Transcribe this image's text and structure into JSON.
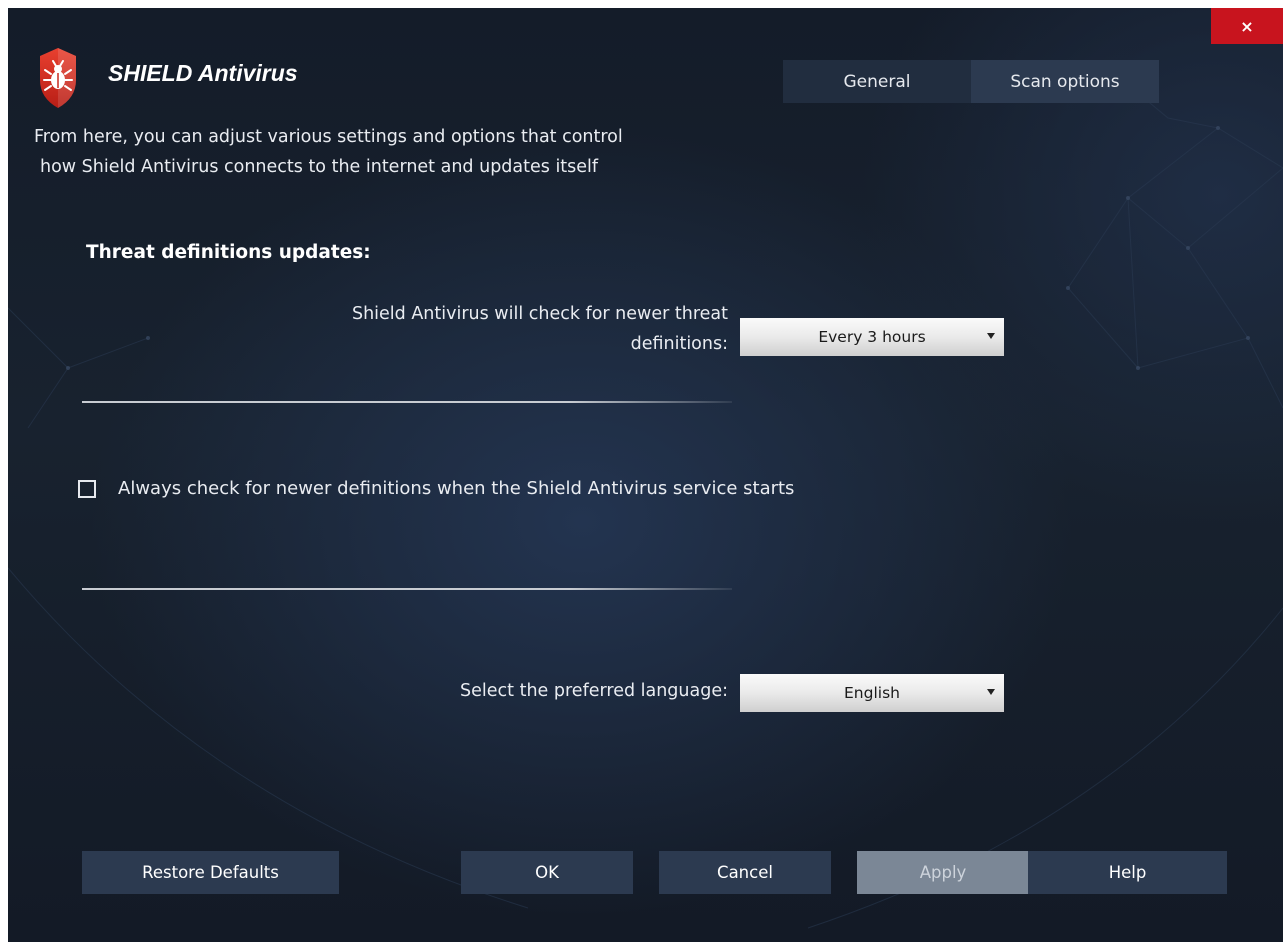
{
  "window": {
    "close_label": "×"
  },
  "header": {
    "title": "SHIELD Antivirus",
    "logo_icon": "shield-bug-icon"
  },
  "tabs": [
    {
      "label": "General"
    },
    {
      "label": "Scan options"
    }
  ],
  "description": {
    "line1": "From here, you can adjust various settings and options that control",
    "line2": "how Shield Antivirus connects to the internet and updates itself"
  },
  "updates": {
    "heading": "Threat definitions updates:",
    "check_label_line1": "Shield Antivirus will check for newer threat",
    "check_label_line2": "definitions:",
    "frequency_value": "Every 3 hours",
    "always_check_label": "Always check for newer definitions when the Shield Antivirus service starts",
    "always_check_checked": false
  },
  "language": {
    "label": "Select the preferred language:",
    "value": "English"
  },
  "buttons": {
    "restore": "Restore Defaults",
    "ok": "OK",
    "cancel": "Cancel",
    "apply": "Apply",
    "help": "Help"
  },
  "colors": {
    "accent_red": "#c8141e",
    "background": "#18222f",
    "button": "#2c3a50",
    "button_disabled": "#7b8796"
  }
}
